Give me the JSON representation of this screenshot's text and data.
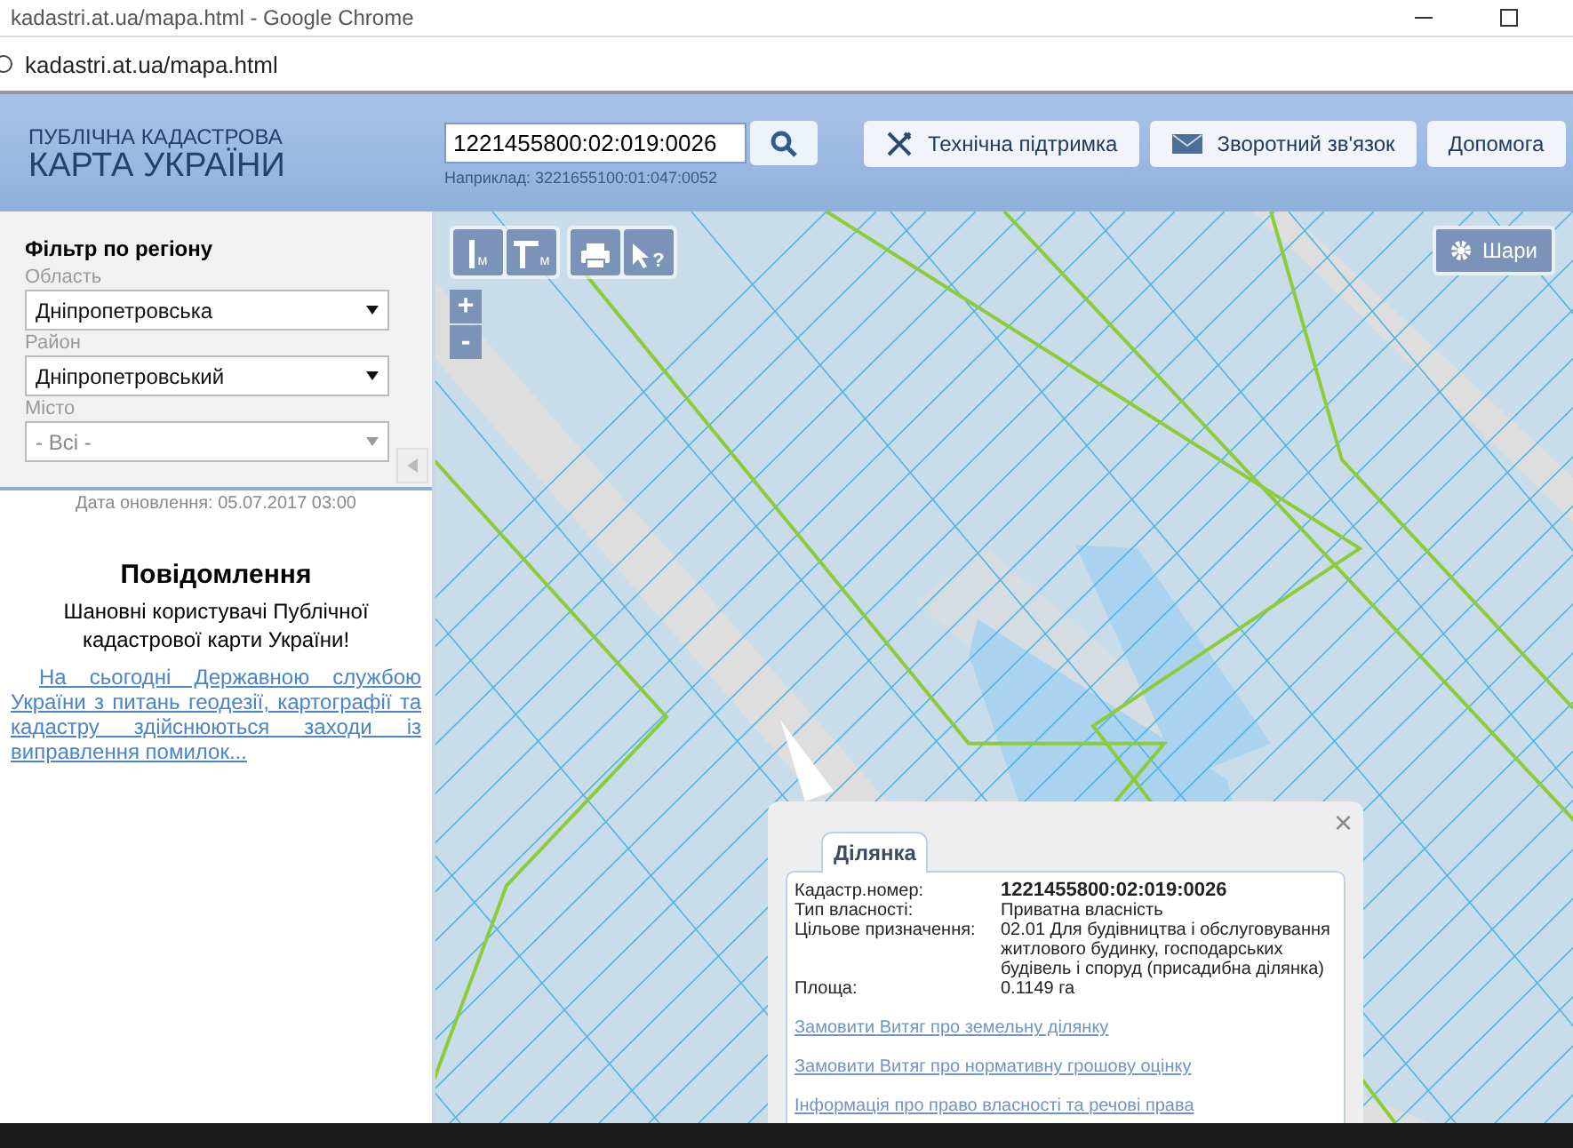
{
  "window": {
    "title": "kadastri.at.ua/mapa.html - Google Chrome"
  },
  "address_bar": {
    "url": "kadastri.at.ua/mapa.html"
  },
  "header": {
    "logo_line1": "ПУБЛІЧНА КАДАСТРОВА",
    "logo_line2": "КАРТА УКРАЇНИ",
    "search": {
      "value": "1221455800:02:019:0026",
      "example": "Наприклад: 3221655100:01:047:0052"
    },
    "buttons": [
      {
        "label": "Технічна підтримка",
        "kind": "tools"
      },
      {
        "label": "Зворотний зв'язок",
        "kind": "mail"
      },
      {
        "label": "Допомога",
        "kind": "plain"
      }
    ]
  },
  "filter": {
    "title": "Фільтр по регіону",
    "fields": [
      {
        "label": "Область",
        "value": "Дніпропетровська",
        "disabled": false
      },
      {
        "label": "Район",
        "value": "Дніпропетровський",
        "disabled": false
      },
      {
        "label": "Місто",
        "value": "- Всі -",
        "disabled": true
      }
    ]
  },
  "update_date": "Дата оновлення: 05.07.2017 03:00",
  "notice": {
    "title": "Повідомлення",
    "text": "Шановні користувачі Публічної кадастрової карти України!",
    "link": "На сьогодні Державною службою України з питань геодезії, картографії та кадастру здійснюються заходи із виправлення помилок..."
  },
  "map": {
    "tools": [
      {
        "kind": "ruler",
        "label": "м"
      },
      {
        "kind": "area",
        "label": "м"
      },
      {
        "kind": "print"
      },
      {
        "kind": "identify",
        "label": "?"
      }
    ],
    "zoom": [
      "+",
      "-"
    ],
    "layers_button": "Шари"
  },
  "popup": {
    "tab": "Ділянка",
    "close": "×",
    "rows": [
      {
        "label": "Кадастр.номер:",
        "value": "1221455800:02:019:0026",
        "bold": true
      },
      {
        "label": "Тип власності:",
        "value": "Приватна власність",
        "bold": false
      },
      {
        "label": "Цільове призначення:",
        "value": "02.01 Для будівництва і обслуговування житлового будинку, господарських будівель і споруд (присадибна ділянка)",
        "bold": false
      },
      {
        "label": "Площа:",
        "value": "0.1149 га",
        "bold": false
      }
    ],
    "links": [
      "Замовити Витяг про земельну ділянку",
      "Замовити Витяг про нормативну грошову оцінку",
      "Інформація про право власності та речові права"
    ]
  }
}
